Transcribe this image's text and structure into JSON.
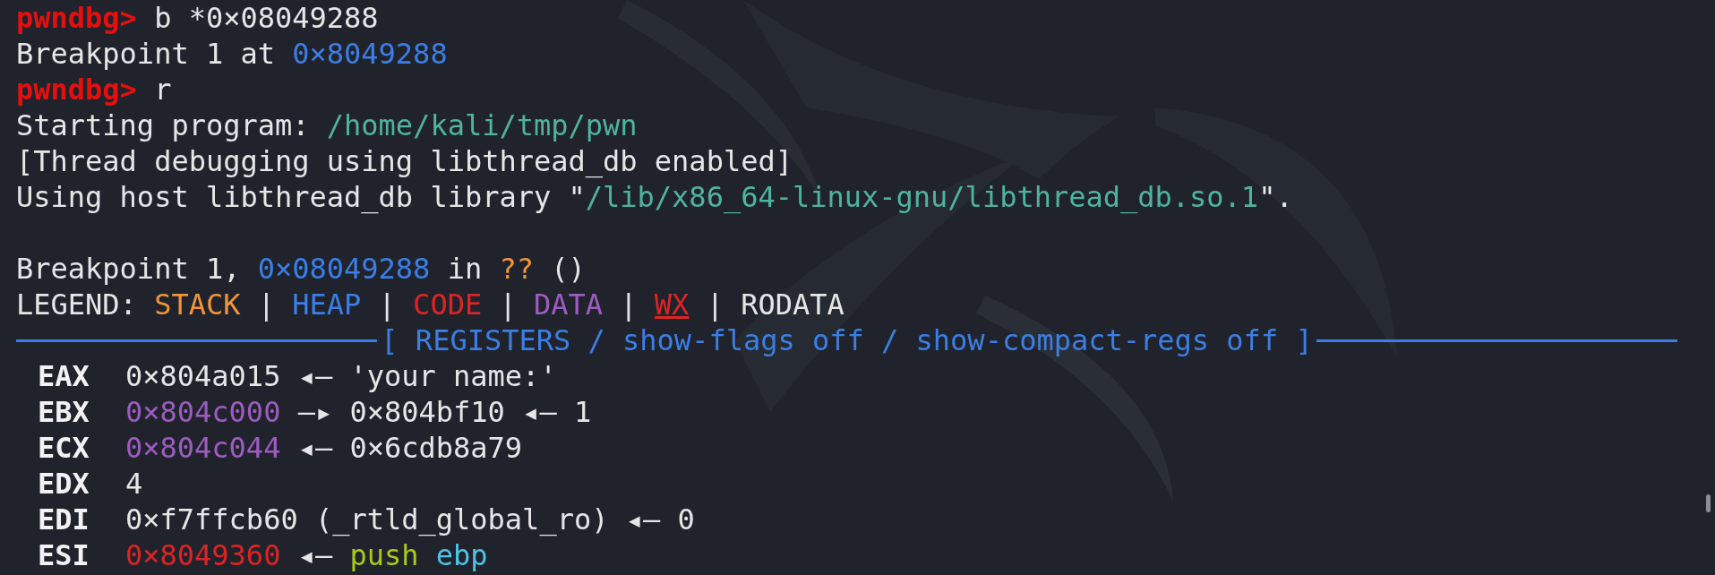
{
  "lines": [
    {
      "segments": [
        {
          "text": "pwndbg>",
          "kind": "prompt"
        },
        {
          "text": " b *0×08049288",
          "kind": "text"
        }
      ]
    },
    {
      "segments": [
        {
          "text": "Breakpoint 1 at ",
          "kind": "text"
        },
        {
          "text": "0×8049288",
          "kind": "heap"
        }
      ]
    },
    {
      "segments": [
        {
          "text": "pwndbg>",
          "kind": "prompt"
        },
        {
          "text": " r",
          "kind": "text"
        }
      ]
    },
    {
      "segments": [
        {
          "text": "Starting program: ",
          "kind": "text"
        },
        {
          "text": "/home/kali/tmp/pwn",
          "kind": "path"
        }
      ]
    },
    {
      "segments": [
        {
          "text": "[Thread debugging using libthread_db enabled]",
          "kind": "text"
        }
      ]
    },
    {
      "segments": [
        {
          "text": "Using host libthread_db library \"",
          "kind": "text"
        },
        {
          "text": "/lib/x86_64-linux-gnu/libthread_db.so.1",
          "kind": "path"
        },
        {
          "text": "\".",
          "kind": "text"
        }
      ]
    }
  ],
  "stop_lines": [
    {
      "segments": [
        {
          "text": "Breakpoint 1, ",
          "kind": "text"
        },
        {
          "text": "0×08049288",
          "kind": "heap"
        },
        {
          "text": " in ",
          "kind": "text"
        },
        {
          "text": "??",
          "kind": "stack"
        },
        {
          "text": " ()",
          "kind": "text"
        }
      ]
    },
    {
      "segments": [
        {
          "text": "LEGEND: ",
          "kind": "text"
        },
        {
          "text": "STACK",
          "kind": "stack"
        },
        {
          "text": " | ",
          "kind": "text"
        },
        {
          "text": "HEAP",
          "kind": "heap"
        },
        {
          "text": " | ",
          "kind": "text"
        },
        {
          "text": "CODE",
          "kind": "code"
        },
        {
          "text": " | ",
          "kind": "text"
        },
        {
          "text": "DATA",
          "kind": "data"
        },
        {
          "text": " | ",
          "kind": "text"
        },
        {
          "text": "WX",
          "kind": "wx"
        },
        {
          "text": " | ",
          "kind": "text"
        },
        {
          "text": "RODATA",
          "kind": "text"
        }
      ]
    }
  ],
  "section_header": "[ REGISTERS / show-flags off / show-compact-regs off ]",
  "registers": [
    {
      "name": "EAX",
      "segments": [
        {
          "text": "0×804a015",
          "kind": "text"
        },
        {
          "text": " ◂— 'your name:'",
          "kind": "text"
        }
      ]
    },
    {
      "name": "EBX",
      "segments": [
        {
          "text": "0×804c000",
          "kind": "data"
        },
        {
          "text": " —▸ 0×804bf10 ◂— 1",
          "kind": "text"
        }
      ]
    },
    {
      "name": "ECX",
      "segments": [
        {
          "text": "0×804c044",
          "kind": "data"
        },
        {
          "text": " ◂— 0×6cdb8a79",
          "kind": "text"
        }
      ]
    },
    {
      "name": "EDX",
      "segments": [
        {
          "text": "4",
          "kind": "text"
        }
      ]
    },
    {
      "name": "EDI",
      "segments": [
        {
          "text": "0×f7ffcb60 (_rtld_global_ro) ◂— 0",
          "kind": "text"
        }
      ]
    },
    {
      "name": "ESI",
      "segments": [
        {
          "text": "0×8049360",
          "kind": "code"
        },
        {
          "text": " ◂— ",
          "kind": "text"
        },
        {
          "text": "push",
          "kind": "instr"
        },
        {
          "text": " ebp",
          "kind": "reg"
        }
      ]
    }
  ]
}
